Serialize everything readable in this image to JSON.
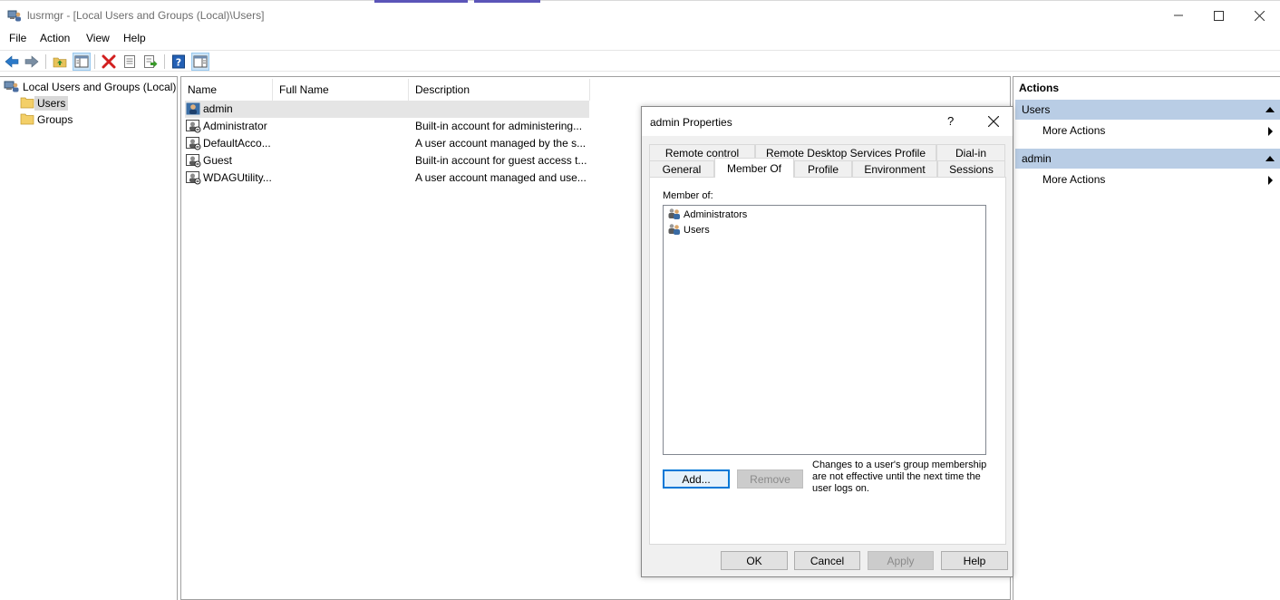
{
  "window": {
    "title": "lusrmgr - [Local Users and Groups (Local)\\Users]",
    "minimize": "—",
    "maximize": "☐",
    "close": "✕"
  },
  "menu": [
    "File",
    "Action",
    "View",
    "Help"
  ],
  "toolbar": {
    "buttons": [
      "back-icon",
      "forward-icon",
      "up-folder-icon",
      "show-hide-tree-icon",
      "delete-icon",
      "properties-icon",
      "export-list-icon",
      "help-icon",
      "show-hide-action-pane-icon"
    ]
  },
  "tree": {
    "root": "Local Users and Groups (Local)",
    "children": [
      "Users",
      "Groups"
    ],
    "selected": "Users"
  },
  "list": {
    "columns": [
      "Name",
      "Full Name",
      "Description"
    ],
    "rows": [
      {
        "name": "admin",
        "full_name": "",
        "description": ""
      },
      {
        "name": "Administrator",
        "full_name": "",
        "description": "Built-in account for administering..."
      },
      {
        "name": "DefaultAcco...",
        "full_name": "",
        "description": "A user account managed by the s..."
      },
      {
        "name": "Guest",
        "full_name": "",
        "description": "Built-in account for guest access t..."
      },
      {
        "name": "WDAGUtility...",
        "full_name": "",
        "description": "A user account managed and use..."
      }
    ]
  },
  "actions": {
    "title": "Actions",
    "sections": [
      {
        "header": "Users",
        "items": [
          "More Actions"
        ]
      },
      {
        "header": "admin",
        "items": [
          "More Actions"
        ]
      }
    ]
  },
  "dialog": {
    "title": "admin Properties",
    "help": "?",
    "tabs_row1": [
      "Remote control",
      "Remote Desktop Services Profile",
      "Dial-in"
    ],
    "tabs_row2": [
      "General",
      "Member Of",
      "Profile",
      "Environment",
      "Sessions"
    ],
    "active_tab": "Member Of",
    "member_of_label": "Member of:",
    "groups": [
      "Administrators",
      "Users"
    ],
    "add_button": "Add...",
    "remove_button": "Remove",
    "note": "Changes to a user's group membership are not effective until the next time the user logs on.",
    "ok_button": "OK",
    "cancel_button": "Cancel",
    "apply_button": "Apply",
    "help_button": "Help"
  }
}
